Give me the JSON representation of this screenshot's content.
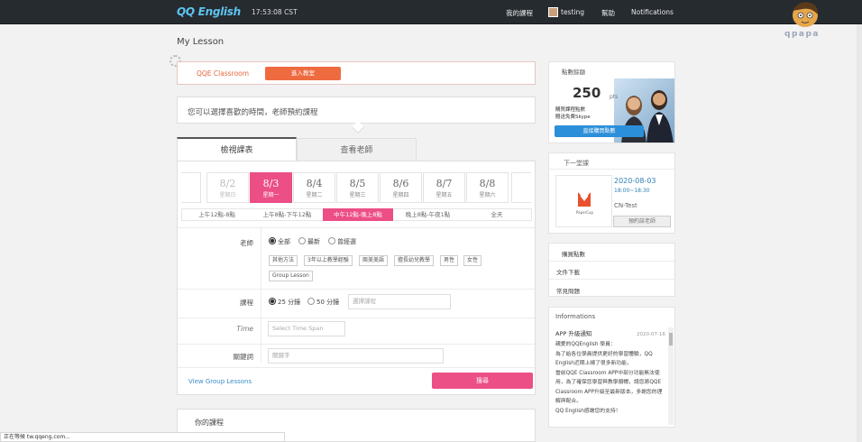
{
  "header": {
    "logo": "QQ English",
    "clock": "17:53:08 CST",
    "nav": {
      "my_lessons": "我的課程",
      "user": "testing",
      "help": "幫助",
      "notifications": "Notifications"
    }
  },
  "watermark": "qpapa",
  "page_title": "My Lesson",
  "classroom": {
    "label": "QQE Classroom",
    "button": "進入教室"
  },
  "hint": "您可以選擇喜歡的時間，老師預約課程",
  "tabs": {
    "schedule": "檢視課表",
    "teacher": "查看老師"
  },
  "dates": [
    {
      "date": "8/2",
      "day": "星期日",
      "state": "faded"
    },
    {
      "date": "8/3",
      "day": "星期一",
      "state": "active"
    },
    {
      "date": "8/4",
      "day": "星期二",
      "state": "normal"
    },
    {
      "date": "8/5",
      "day": "星期三",
      "state": "normal"
    },
    {
      "date": "8/6",
      "day": "星期四",
      "state": "normal"
    },
    {
      "date": "8/7",
      "day": "星期五",
      "state": "normal"
    },
    {
      "date": "8/8",
      "day": "星期六",
      "state": "normal"
    }
  ],
  "time_slots": [
    "上午12點-8點",
    "上午8點-下午12點",
    "中午12點-晚上8點",
    "晚上8點-午夜1點",
    "全天"
  ],
  "active_slot": 2,
  "filters": {
    "teacher_label": "老師",
    "teacher_options": [
      "全部",
      "最新",
      "曾經選"
    ],
    "teacher_selected": 0,
    "chips": [
      "其他方法",
      "3年以上教學經驗",
      "兩美美語",
      "擅長幼兒教學",
      "男性",
      "女性",
      "Group Lesson"
    ],
    "course_label": "課程",
    "course_options": [
      "25 分鐘",
      "50 分鐘"
    ],
    "course_selected": 0,
    "course_placeholder": "選擇課程",
    "time_label": "Time",
    "time_placeholder": "Select Time Span",
    "keyword_label": "關鍵詞",
    "keyword_placeholder": "關鍵字",
    "group_link": "View Group Lessons",
    "search_button": "搜尋"
  },
  "lessons_section": {
    "title": "你的課程"
  },
  "promo": {
    "title": "點數餘額",
    "points": "250",
    "unit": "pts",
    "note1": "購買課程點數",
    "note2": "贈送免費Skype",
    "button": "直接購買點數"
  },
  "next_lesson": {
    "title": "下一堂課",
    "date": "2020-08-03",
    "time": "18:00~18:30",
    "teacher": "CN-Test",
    "button": "預約該老師",
    "logo_caption": "PaperCup"
  },
  "side_links": [
    "購買點數",
    "文件下載",
    "常見問題"
  ],
  "info": {
    "title": "Informations",
    "item_title": "APP 升級通知",
    "item_date": "2020-07-16",
    "body": [
      "親愛的QQEnglish 學員：",
      "為了給各位學員提供更好的學習體驗，QQ English近期上線了很多新功能，",
      "當前QQE Classroom APP中部分功能無法使用，為了確保您學習與教學順暢，請您將QQE Classroom APP升級至最新版本，多謝您的理解與配合。",
      "QQ English感謝您的支持！"
    ]
  },
  "status_bar": "正在等候 tw.qqeng.com...",
  "colors": {
    "pink": "#ec4e86",
    "orange": "#ee6b40",
    "blue": "#2c8fd9",
    "topbar": "#262b30"
  }
}
